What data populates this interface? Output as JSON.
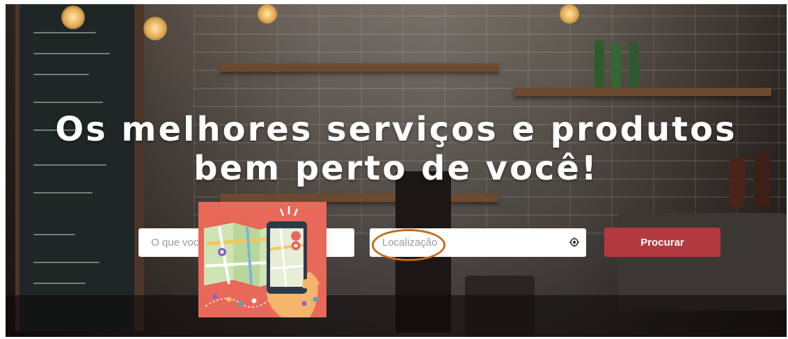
{
  "hero": {
    "title_line1": "Os melhores serviços e produtos",
    "title_line2": "bem perto de você!"
  },
  "search": {
    "what_placeholder": "O que você procura?",
    "location_placeholder": "Localização",
    "location_icon": "target-location-icon",
    "submit_label": "Procurar"
  },
  "colors": {
    "button": "#b23a3f",
    "annotation": "#c66a1c",
    "overlay": "#e8685a"
  }
}
